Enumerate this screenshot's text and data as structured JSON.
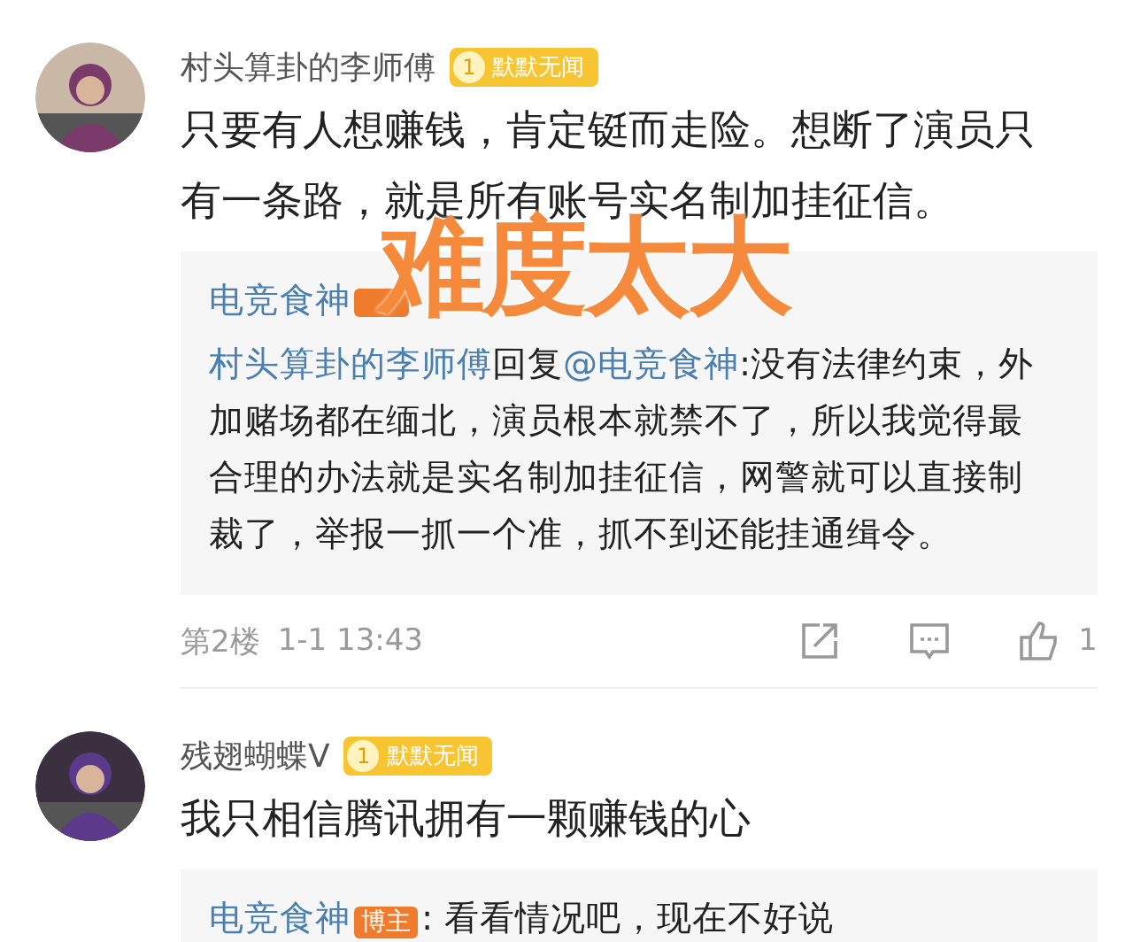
{
  "comments": [
    {
      "author": "村头算卦的李师傅",
      "badge": {
        "level": "1",
        "label": "默默无闻"
      },
      "text": "只要有人想赚钱，肯定铤而走险。想断了演员只有一条路，就是所有账号实名制加挂征信。",
      "replies": [
        {
          "author": "电竞食神",
          "role_block": true,
          "text_hidden": true
        },
        {
          "author": "村头算卦的李师傅",
          "action": "回复",
          "mention": "@电竞食神",
          "text": ":没有法律约束，外加赌场都在缅北，演员根本就禁不了，所以我觉得最合理的办法就是实名制加挂征信，网警就可以直接制裁了，举报一抓一个准，抓不到还能挂通缉令。"
        }
      ],
      "footer": {
        "floor": "第2楼",
        "time": "1-1 13:43",
        "likes": "1"
      }
    },
    {
      "author": "残翅蝴蝶V",
      "badge": {
        "level": "1",
        "label": "默默无闻"
      },
      "text": "我只相信腾讯拥有一颗赚钱的心",
      "replies": [
        {
          "author": "电竞食神",
          "role": "博主",
          "text": ": 看看情况吧，现在不好说"
        }
      ]
    }
  ],
  "overlay_text": "难度太大"
}
